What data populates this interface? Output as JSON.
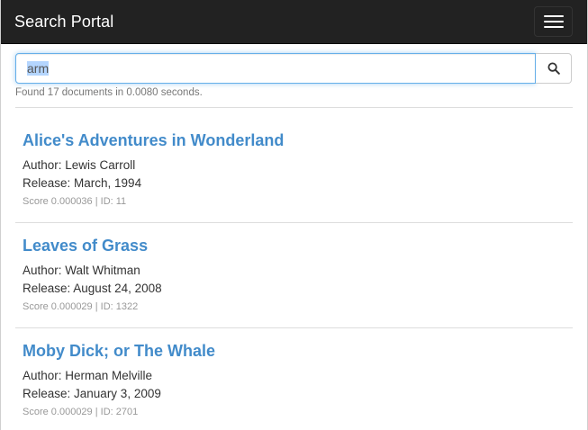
{
  "navbar": {
    "brand": "Search Portal",
    "menu_icon": "hamburger-menu-icon"
  },
  "search": {
    "query": "arm",
    "button_icon": "search-icon",
    "status": "Found 17 documents in 0.0080 seconds."
  },
  "results": [
    {
      "title": "Alice's Adventures in Wonderland",
      "author": "Author: Lewis Carroll",
      "release": "Release: March, 1994",
      "meta": "Score 0.000036 | ID: 11"
    },
    {
      "title": "Leaves of Grass",
      "author": "Author: Walt Whitman",
      "release": "Release: August 24, 2008",
      "meta": "Score 0.000029 | ID: 1322"
    },
    {
      "title": "Moby Dick; or The Whale",
      "author": "Author: Herman Melville",
      "release": "Release: January 3, 2009",
      "meta": "Score 0.000029 | ID: 2701"
    }
  ],
  "colors": {
    "navbar_bg": "#222222",
    "link": "#428bca",
    "focus_border": "#66afe9",
    "muted": "#777777"
  }
}
